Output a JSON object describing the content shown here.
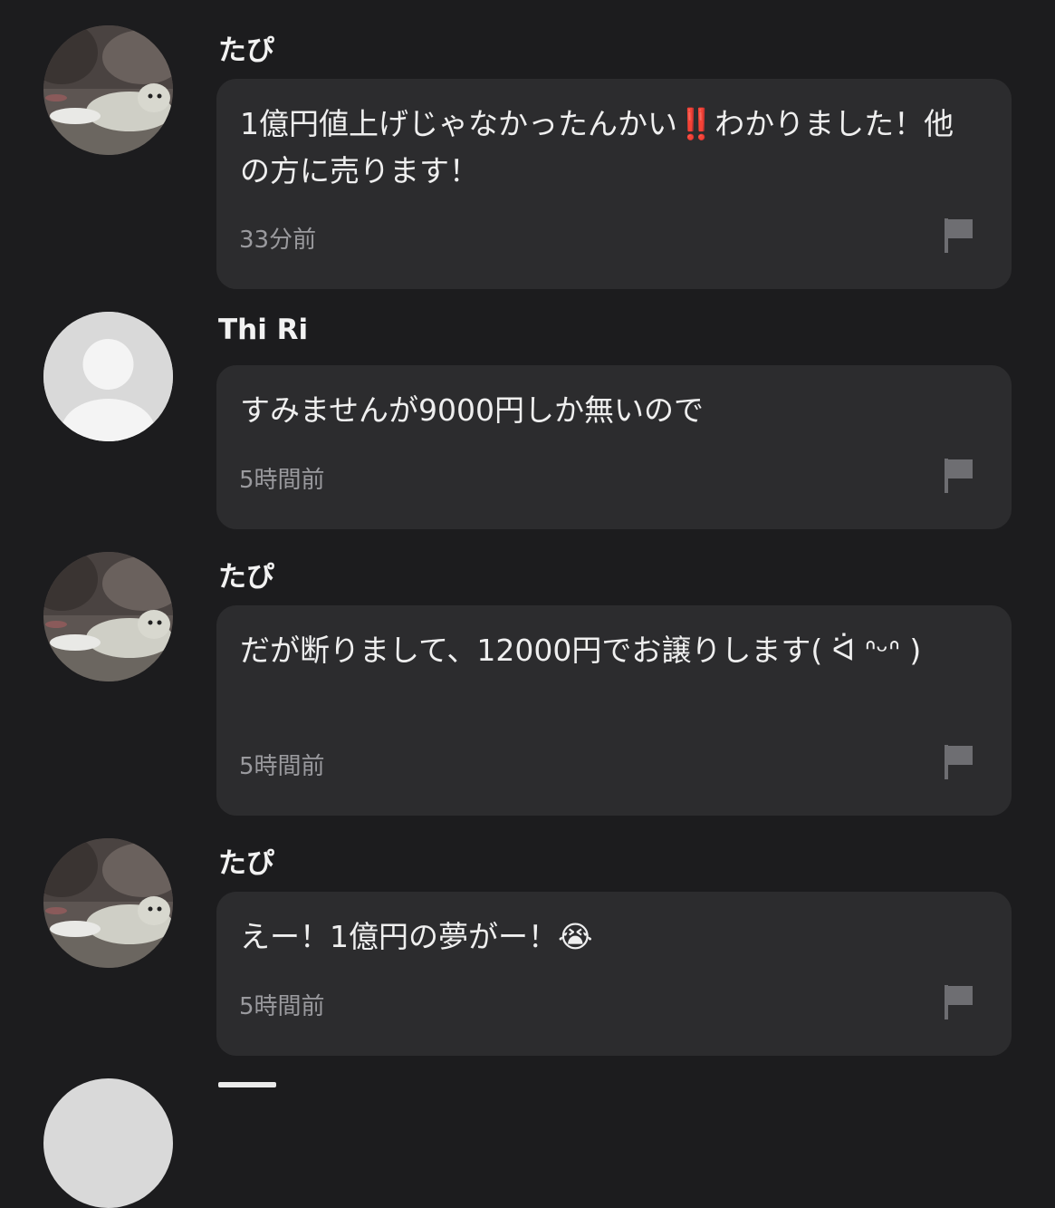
{
  "comments": [
    {
      "username": "たぴ",
      "avatar": "seal-photo",
      "message": "1億円値上げじゃなかったんかい‼️わかりました！他の方に売ります！",
      "time": "33分前"
    },
    {
      "username": "Thi Ri",
      "avatar": "default-user",
      "message": "すみませんが9000円しか無いので",
      "time": "5時間前"
    },
    {
      "username": "たぴ",
      "avatar": "seal-photo",
      "message": "だが断りまして、12000円でお譲りします( ᐛ ᐢᵕᐢ )",
      "time": "5時間前"
    },
    {
      "username": "たぴ",
      "avatar": "seal-photo",
      "message": "えー！1億円の夢がー！😭",
      "time": "5時間前"
    }
  ],
  "icons": {
    "flag": "flag-icon",
    "default_avatar": "user-silhouette-icon"
  },
  "colors": {
    "background": "#1c1c1e",
    "bubble": "#2c2c2e",
    "text": "#efefef",
    "timestamp": "#9a9a9e",
    "flag": "#6e6e72"
  }
}
